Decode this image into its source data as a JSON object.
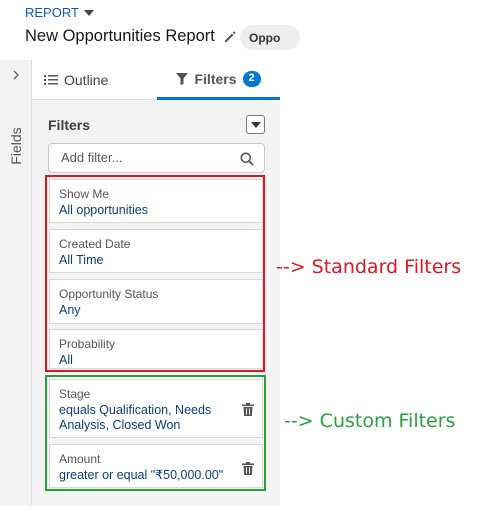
{
  "header": {
    "report_label": "REPORT",
    "title": "New Opportunities Report",
    "pill_text": "Oppo"
  },
  "sidebar": {
    "fields_label": "Fields"
  },
  "tabs": {
    "outline_label": "Outline",
    "filters_label": "Filters",
    "filters_count": "2"
  },
  "filters_panel": {
    "heading": "Filters",
    "search_placeholder": "Add filter..."
  },
  "standard_filters": [
    {
      "label": "Show Me",
      "value": "All opportunities"
    },
    {
      "label": "Created Date",
      "value": "All Time"
    },
    {
      "label": "Opportunity Status",
      "value": "Any"
    },
    {
      "label": "Probability",
      "value": "All"
    }
  ],
  "custom_filters": [
    {
      "label": "Stage",
      "value_line1": "equals Qualification, Needs",
      "value_line2": "Analysis, Closed Won"
    },
    {
      "label": "Amount",
      "value_line1": "greater or equal \"₹50,000.00\""
    }
  ],
  "annotations": {
    "standard": "--> Standard Filters",
    "custom": "--> Custom Filters"
  },
  "colors": {
    "accent": "#0176d3",
    "standard_box": "#e3141e",
    "custom_box": "#24a33c"
  }
}
